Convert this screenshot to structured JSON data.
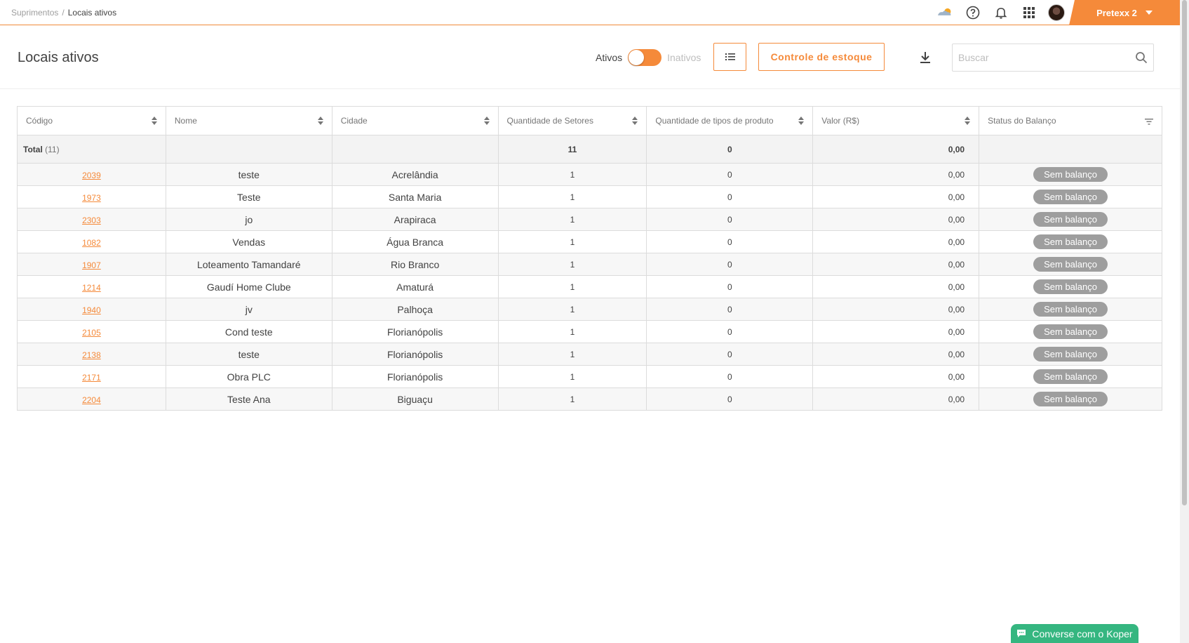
{
  "breadcrumb": {
    "parent": "Suprimentos",
    "separator": "/",
    "current": "Locais ativos"
  },
  "topbar": {
    "org_name": "Pretexx 2",
    "icons": [
      "weather-icon",
      "help-icon",
      "bell-icon",
      "apps-grid-icon",
      "avatar"
    ]
  },
  "header": {
    "title": "Locais ativos",
    "toggle_on_label": "Ativos",
    "toggle_off_label": "Inativos",
    "stock_button": "Controle de estoque",
    "search_placeholder": "Buscar"
  },
  "table": {
    "columns": [
      "Código",
      "Nome",
      "Cidade",
      "Quantidade de Setores",
      "Quantidade de tipos de produto",
      "Valor (R$)",
      "Status do Balanço"
    ],
    "total": {
      "label": "Total",
      "count": "(11)",
      "setores": "11",
      "tipos": "0",
      "valor": "0,00"
    },
    "rows": [
      {
        "codigo": "2039",
        "nome": "teste",
        "cidade": "Acrelândia",
        "setores": "1",
        "tipos": "0",
        "valor": "0,00",
        "status": "Sem balanço"
      },
      {
        "codigo": "1973",
        "nome": "Teste",
        "cidade": "Santa Maria",
        "setores": "1",
        "tipos": "0",
        "valor": "0,00",
        "status": "Sem balanço"
      },
      {
        "codigo": "2303",
        "nome": "jo",
        "cidade": "Arapiraca",
        "setores": "1",
        "tipos": "0",
        "valor": "0,00",
        "status": "Sem balanço"
      },
      {
        "codigo": "1082",
        "nome": "Vendas",
        "cidade": "Água Branca",
        "setores": "1",
        "tipos": "0",
        "valor": "0,00",
        "status": "Sem balanço"
      },
      {
        "codigo": "1907",
        "nome": "Loteamento Tamandaré",
        "cidade": "Rio Branco",
        "setores": "1",
        "tipos": "0",
        "valor": "0,00",
        "status": "Sem balanço"
      },
      {
        "codigo": "1214",
        "nome": "Gaudí Home Clube",
        "cidade": "Amaturá",
        "setores": "1",
        "tipos": "0",
        "valor": "0,00",
        "status": "Sem balanço"
      },
      {
        "codigo": "1940",
        "nome": "jv",
        "cidade": "Palhoça",
        "setores": "1",
        "tipos": "0",
        "valor": "0,00",
        "status": "Sem balanço"
      },
      {
        "codigo": "2105",
        "nome": "Cond teste",
        "cidade": "Florianópolis",
        "setores": "1",
        "tipos": "0",
        "valor": "0,00",
        "status": "Sem balanço"
      },
      {
        "codigo": "2138",
        "nome": "teste",
        "cidade": "Florianópolis",
        "setores": "1",
        "tipos": "0",
        "valor": "0,00",
        "status": "Sem balanço"
      },
      {
        "codigo": "2171",
        "nome": "Obra PLC",
        "cidade": "Florianópolis",
        "setores": "1",
        "tipos": "0",
        "valor": "0,00",
        "status": "Sem balanço"
      },
      {
        "codigo": "2204",
        "nome": "Teste Ana",
        "cidade": "Biguaçu",
        "setores": "1",
        "tipos": "0",
        "valor": "0,00",
        "status": "Sem balanço"
      }
    ]
  },
  "chat": {
    "label": "Converse com o Koper"
  },
  "colors": {
    "accent": "#f58a3a",
    "badge": "#9e9e9e",
    "chat": "#35b680"
  }
}
